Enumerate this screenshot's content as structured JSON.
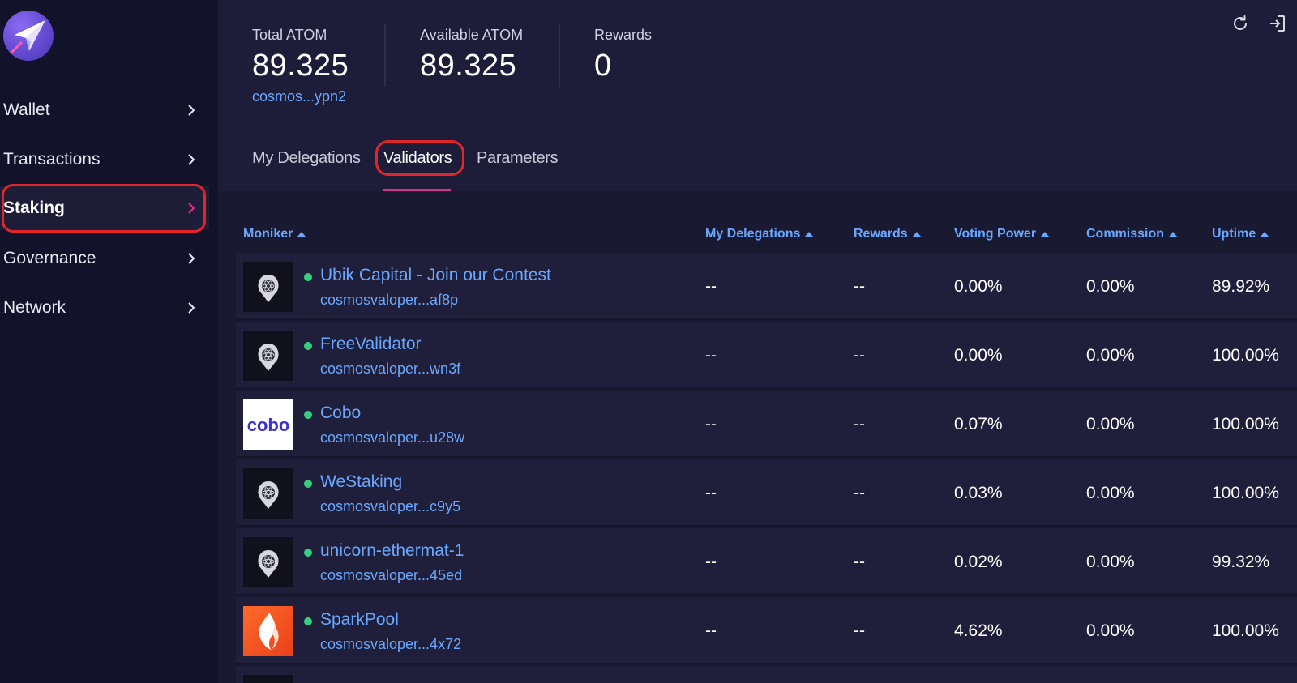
{
  "sidebar": {
    "items": [
      {
        "label": "Wallet"
      },
      {
        "label": "Transactions"
      },
      {
        "label": "Staking"
      },
      {
        "label": "Governance"
      },
      {
        "label": "Network"
      }
    ],
    "active_item": "Staking"
  },
  "stats": {
    "total": {
      "label": "Total ATOM",
      "value": "89.325",
      "address": "cosmos...ypn2"
    },
    "available": {
      "label": "Available ATOM",
      "value": "89.325"
    },
    "rewards": {
      "label": "Rewards",
      "value": "0"
    }
  },
  "top_icons": [
    "refresh-icon",
    "logout-icon"
  ],
  "tabs": [
    {
      "label": "My Delegations"
    },
    {
      "label": "Validators"
    },
    {
      "label": "Parameters"
    }
  ],
  "active_tab": "Validators",
  "table": {
    "headers": [
      "Moniker",
      "My Delegations",
      "Rewards",
      "Voting Power",
      "Commission",
      "Uptime"
    ],
    "rows": [
      {
        "moniker": "Ubik Capital - Join our Contest",
        "operator": "cosmosvaloper...af8p",
        "my_delegations": "--",
        "rewards": "--",
        "voting_power": "0.00%",
        "commission": "0.00%",
        "uptime": "89.92%",
        "avatar": "default"
      },
      {
        "moniker": "FreeValidator",
        "operator": "cosmosvaloper...wn3f",
        "my_delegations": "--",
        "rewards": "--",
        "voting_power": "0.00%",
        "commission": "0.00%",
        "uptime": "100.00%",
        "avatar": "default"
      },
      {
        "moniker": "Cobo",
        "operator": "cosmosvaloper...u28w",
        "my_delegations": "--",
        "rewards": "--",
        "voting_power": "0.07%",
        "commission": "0.00%",
        "uptime": "100.00%",
        "avatar": "cobo",
        "avatar_text": "cobo"
      },
      {
        "moniker": "WeStaking",
        "operator": "cosmosvaloper...c9y5",
        "my_delegations": "--",
        "rewards": "--",
        "voting_power": "0.03%",
        "commission": "0.00%",
        "uptime": "100.00%",
        "avatar": "default"
      },
      {
        "moniker": "unicorn-ethermat-1",
        "operator": "cosmosvaloper...45ed",
        "my_delegations": "--",
        "rewards": "--",
        "voting_power": "0.02%",
        "commission": "0.00%",
        "uptime": "99.32%",
        "avatar": "default"
      },
      {
        "moniker": "SparkPool",
        "operator": "cosmosvaloper...4x72",
        "my_delegations": "--",
        "rewards": "--",
        "voting_power": "4.62%",
        "commission": "0.00%",
        "uptime": "100.00%",
        "avatar": "sparkpool"
      }
    ]
  },
  "colors": {
    "accent_link": "#6aa8ff",
    "tab_underline": "#d6348c",
    "status_active": "#35d07f",
    "highlight_annotation": "#e0252b"
  }
}
